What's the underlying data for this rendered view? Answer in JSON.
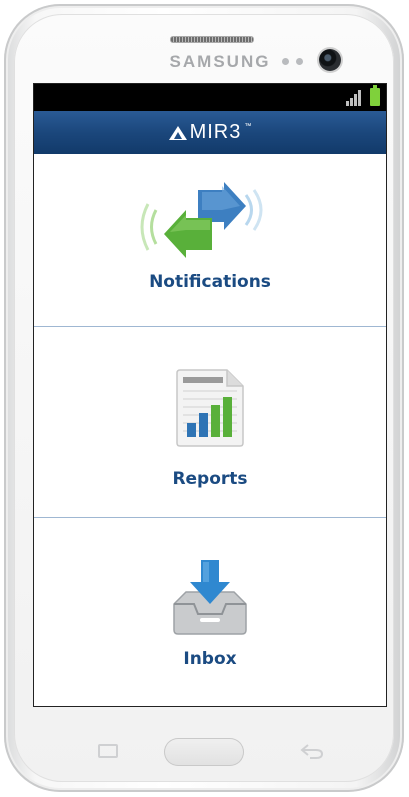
{
  "device": {
    "brand": "SAMSUNG"
  },
  "app": {
    "title": "MIR3",
    "trademark": "™",
    "accent_color": "#1b477c"
  },
  "menu": {
    "items": [
      {
        "id": "notifications",
        "label": "Notifications",
        "icon": "notifications-arrows-icon"
      },
      {
        "id": "reports",
        "label": "Reports",
        "icon": "reports-chart-icon"
      },
      {
        "id": "inbox",
        "label": "Inbox",
        "icon": "inbox-tray-icon"
      }
    ]
  },
  "status": {
    "icons": [
      "signal-icon",
      "battery-icon"
    ],
    "battery_color": "#7fd13b"
  },
  "hardware_keys": [
    "menu-key-icon",
    "home-button",
    "back-key-icon"
  ]
}
